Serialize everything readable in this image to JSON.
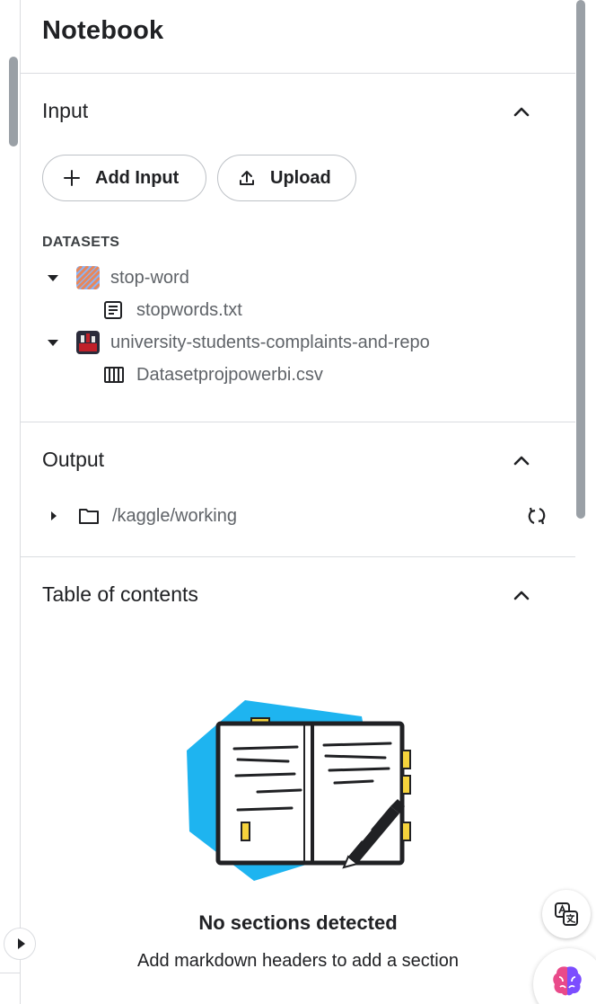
{
  "panel": {
    "title": "Notebook"
  },
  "input": {
    "heading": "Input",
    "add_input_label": "Add Input",
    "upload_label": "Upload",
    "datasets_label": "DATASETS",
    "datasets": [
      {
        "name": "stop-word",
        "files": [
          "stopwords.txt"
        ]
      },
      {
        "name": "university-students-complaints-and-repo",
        "files": [
          "Datasetprojpowerbi.csv"
        ]
      }
    ]
  },
  "output": {
    "heading": "Output",
    "path": "/kaggle/working"
  },
  "toc": {
    "heading": "Table of contents",
    "empty_title": "No sections detected",
    "empty_subtitle": "Add markdown headers to add a section"
  },
  "colors": {
    "illustration_blue": "#1eb4f0",
    "illustration_yellow": "#f5d33c",
    "dataset1_icon": "#e8875a",
    "dataset2_icon": "#c0202a"
  }
}
